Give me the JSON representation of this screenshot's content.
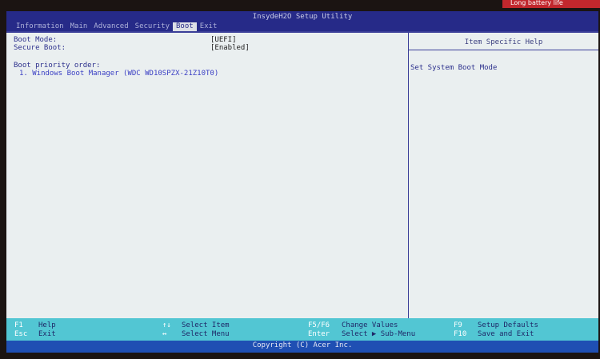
{
  "window": {
    "title": "InsydeH2O Setup Utility",
    "sticker_text": "Long battery life"
  },
  "menu": [
    {
      "label": "Information",
      "active": false
    },
    {
      "label": "Main",
      "active": false
    },
    {
      "label": "Advanced",
      "active": false
    },
    {
      "label": "Security",
      "active": false
    },
    {
      "label": "Boot",
      "active": true
    },
    {
      "label": "Exit",
      "active": false
    }
  ],
  "settings": {
    "boot_mode": {
      "label": "Boot Mode:",
      "value": "[UEFI]"
    },
    "secure_boot": {
      "label": "Secure Boot:",
      "value": "[Enabled]"
    },
    "priority_heading": "Boot priority order:",
    "priority_items": [
      "1. Windows Boot Manager (WDC WD10SPZX-21Z10T0)"
    ]
  },
  "help": {
    "header": "Item Specific Help",
    "text": "Set System Boot Mode"
  },
  "footer": {
    "f1": {
      "key": "F1",
      "action": "Help"
    },
    "esc": {
      "key": "Esc",
      "action": "Exit"
    },
    "updown": {
      "key": "↑↓",
      "action": "Select Item"
    },
    "leftright": {
      "key": "↔",
      "action": "Select Menu"
    },
    "f5f6": {
      "key": "F5/F6",
      "action": "Change Values"
    },
    "enter": {
      "key": "Enter",
      "action": "Select ▶ Sub-Menu"
    },
    "f9": {
      "key": "F9",
      "action": "Setup Defaults"
    },
    "f10": {
      "key": "F10",
      "action": "Save and Exit"
    }
  },
  "copyright": "Copyright (C) Acer Inc.",
  "colors": {
    "title_bar": "#262a88",
    "screen_bg": "#eaeff0",
    "footer_bg": "#52c6d3",
    "copyright_bg": "#1f4fb3",
    "label_blue": "#2b2f8c"
  }
}
